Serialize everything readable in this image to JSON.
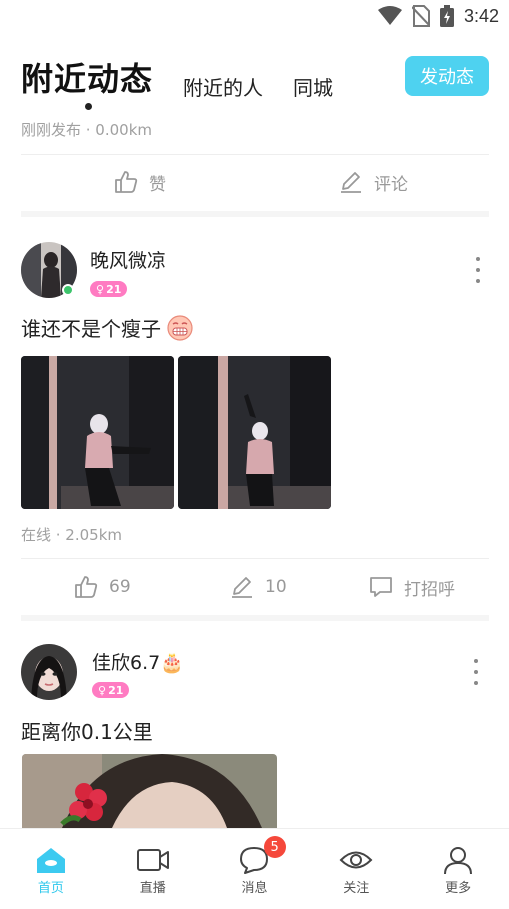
{
  "status_bar": {
    "time": "3:42"
  },
  "header": {
    "tabs": [
      {
        "label": "附近动态",
        "active": true
      },
      {
        "label": "附近的人",
        "active": false
      },
      {
        "label": "同城",
        "active": false
      }
    ],
    "post_button": "发动态"
  },
  "feed": {
    "top_card": {
      "meta": "刚刚发布 · 0.00km",
      "like_label": "赞",
      "comment_label": "评论"
    },
    "posts": [
      {
        "username": "晚风微凉",
        "age": "21",
        "gender_icon": "female-symbol",
        "online": true,
        "text": "谁还不是个瘦子",
        "emoji": "grimace-emoji",
        "images": [
          "mirror-selfie-photo-1",
          "mirror-selfie-photo-2"
        ],
        "meta": "在线 · 2.05km",
        "likes": "69",
        "comments": "10",
        "greet_label": "打招呼"
      },
      {
        "username": "佳欣6.7",
        "username_emoji": "🎂",
        "age": "21",
        "gender_icon": "female-symbol",
        "text": "距离你0.1公里",
        "images": [
          "selfie-with-flower-photo"
        ]
      }
    ]
  },
  "bottom_nav": {
    "items": [
      {
        "label": "首页",
        "icon": "home-icon",
        "active": true
      },
      {
        "label": "直播",
        "icon": "video-camera-icon",
        "active": false
      },
      {
        "label": "消息",
        "icon": "chat-bubble-icon",
        "active": false,
        "badge": "5"
      },
      {
        "label": "关注",
        "icon": "eye-icon",
        "active": false
      },
      {
        "label": "更多",
        "icon": "person-icon",
        "active": false
      }
    ]
  },
  "colors": {
    "accent": "#4ed2f0",
    "active_nav": "#2ec8ec",
    "badge_red": "#f5483b",
    "age_badge": "#ff7bc2",
    "online_green": "#3cc46b"
  }
}
